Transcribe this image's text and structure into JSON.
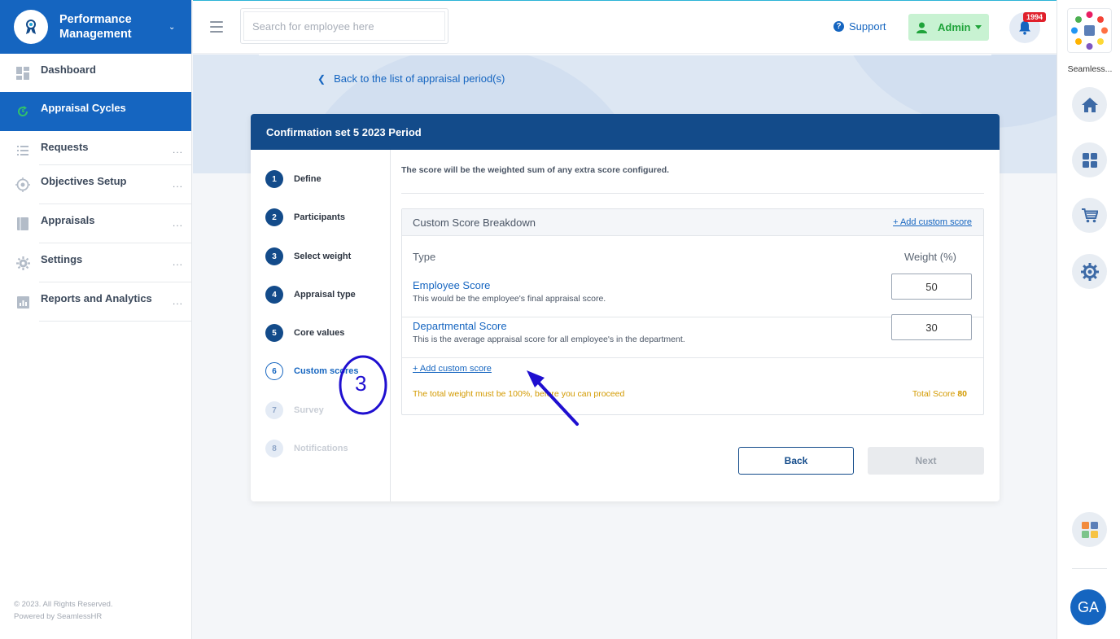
{
  "brand": {
    "title": "Performance Management"
  },
  "sidebar": {
    "items": [
      {
        "label": "Dashboard",
        "icon": "dashboard-icon",
        "dots": ""
      },
      {
        "label": "Appraisal Cycles",
        "icon": "cycle-icon",
        "dots": ""
      },
      {
        "label": "Requests",
        "icon": "list-icon",
        "dots": "..."
      },
      {
        "label": "Objectives Setup",
        "icon": "target-icon",
        "dots": "..."
      },
      {
        "label": "Appraisals",
        "icon": "book-icon",
        "dots": "..."
      },
      {
        "label": "Settings",
        "icon": "gear-icon",
        "dots": "..."
      },
      {
        "label": "Reports and Analytics",
        "icon": "chart-icon",
        "dots": "..."
      }
    ],
    "footer_line1": "© 2023. All Rights Reserved.",
    "footer_line2": "Powered by SeamlessHR"
  },
  "topbar": {
    "search_placeholder": "Search for employee here",
    "support_label": "Support",
    "admin_label": "Admin",
    "notification_count": "1994"
  },
  "rail": {
    "caption": "Seamless...",
    "avatar_initials": "GA"
  },
  "main": {
    "back_link": "Back to the list of appraisal period(s)",
    "card_title": "Confirmation set 5 2023 Period",
    "steps": [
      {
        "num": "1",
        "label": "Define",
        "state": "done"
      },
      {
        "num": "2",
        "label": "Participants",
        "state": "done"
      },
      {
        "num": "3",
        "label": "Select weight",
        "state": "done"
      },
      {
        "num": "4",
        "label": "Appraisal type",
        "state": "done"
      },
      {
        "num": "5",
        "label": "Core values",
        "state": "done"
      },
      {
        "num": "6",
        "label": "Custom scores",
        "state": "current"
      },
      {
        "num": "7",
        "label": "Survey",
        "state": "disabled"
      },
      {
        "num": "8",
        "label": "Notifications",
        "state": "disabled"
      }
    ],
    "description": "The score will be the weighted sum of any extra score configured.",
    "breakdown": {
      "title": "Custom Score Breakdown",
      "add_link_top": "+ Add custom score",
      "col_type": "Type",
      "col_weight": "Weight (%)",
      "rows": [
        {
          "name": "Employee Score",
          "desc": "This would be the employee's final appraisal score.",
          "weight": "50"
        },
        {
          "name": "Departmental Score",
          "desc": "This is the average appraisal score for all employee's in the department.",
          "weight": "30"
        }
      ],
      "add_link_bottom": "+ Add custom score",
      "warning": "The total weight must be 100%, before you can proceed",
      "total_label": "Total Score",
      "total_value": "80"
    },
    "back_button": "Back",
    "next_button": "Next"
  },
  "annotation": {
    "number": "3",
    "color": "#1f0fd0"
  },
  "colors": {
    "primary": "#1565c0",
    "header": "#134b8a",
    "warning": "#d39a00",
    "admin_green": "#1fa33a"
  }
}
